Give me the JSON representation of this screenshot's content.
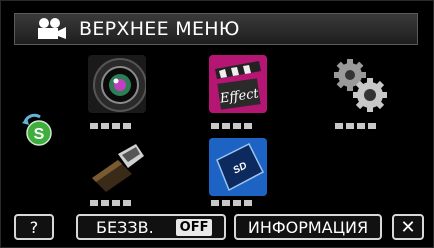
{
  "header": {
    "title": "ВЕРХНЕЕ МЕНЮ",
    "icon": "video-camera-icon"
  },
  "menu": {
    "items": [
      {
        "name": "lens-icon"
      },
      {
        "name": "effect-icon",
        "label": "Effect"
      },
      {
        "name": "gears-icon"
      },
      {
        "name": "hdmi-cable-icon"
      },
      {
        "name": "sd-card-icon",
        "label": "SD"
      }
    ],
    "page_indicator": "S"
  },
  "footer": {
    "help_label": "?",
    "mute_label": "БЕЗЗВ.",
    "mute_state": "OFF",
    "info_label": "ИНФОРМАЦИЯ",
    "close_label": "✕"
  }
}
